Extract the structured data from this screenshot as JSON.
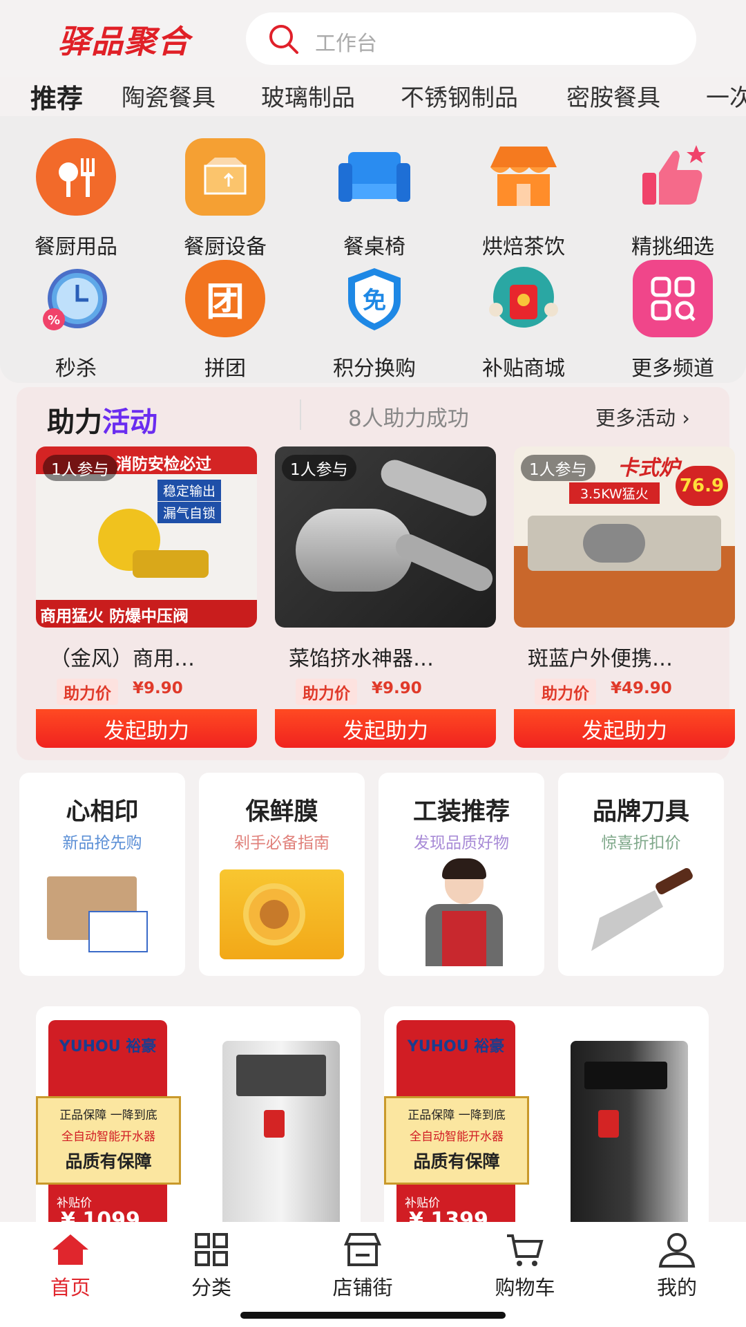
{
  "header": {
    "logo": "驿品聚合",
    "search_placeholder": "工作台"
  },
  "tabs": [
    "推荐",
    "陶瓷餐具",
    "玻璃制品",
    "不锈钢制品",
    "密胺餐具",
    "一次"
  ],
  "categories": [
    {
      "label": "餐厨用品",
      "icon": "tableware-icon",
      "color": "#f26a2a"
    },
    {
      "label": "餐厨设备",
      "icon": "box-icon",
      "color": "#f5a033"
    },
    {
      "label": "餐桌椅",
      "icon": "sofa-icon",
      "color": "#2a8cf0"
    },
    {
      "label": "烘焙茶饮",
      "icon": "shop-icon",
      "color": "#f57a1f"
    },
    {
      "label": "精挑细选",
      "icon": "thumbs-up-icon",
      "color": "#f0436a"
    },
    {
      "label": "秒杀",
      "icon": "alarm-clock-icon",
      "color": "#5fa8e8"
    },
    {
      "label": "拼团",
      "icon": "group-icon",
      "color": "#f2741f",
      "glyph": "团"
    },
    {
      "label": "积分换购",
      "icon": "shield-icon",
      "color": "#1e88e5",
      "glyph": "免"
    },
    {
      "label": "补贴商城",
      "icon": "red-envelope-icon",
      "color": "#2aa7a3"
    },
    {
      "label": "更多频道",
      "icon": "grid-icon",
      "color": "#f0468a"
    }
  ],
  "assist": {
    "title_a": "助力",
    "title_b": "活动",
    "subtitle": "8人助力成功",
    "more": "更多活动",
    "products": [
      {
        "tag": "1人参与",
        "name": "（金风）商用…",
        "price_label": "助力价",
        "price": "¥9.90",
        "button": "发起助力",
        "img_text": "商用猛火 防爆中压阀",
        "img_top": "消防安检必过",
        "img_b1": "稳定输出",
        "img_b2": "漏气自锁"
      },
      {
        "tag": "1人参与",
        "name": "菜馅挤水神器…",
        "price_label": "助力价",
        "price": "¥9.90",
        "button": "发起助力"
      },
      {
        "tag": "1人参与",
        "name": "斑蓝户外便携…",
        "price_label": "助力价",
        "price": "¥49.90",
        "button": "发起助力",
        "img_top": "卡式炉",
        "img_b1": "3.5KW猛火",
        "img_badge": "76.9"
      }
    ]
  },
  "tiles": [
    {
      "title": "心相印",
      "sub": "新品抢先购",
      "sub_color": "#5b8fd6"
    },
    {
      "title": "保鲜膜",
      "sub": "剁手必备指南",
      "sub_color": "#e0807a"
    },
    {
      "title": "工装推荐",
      "sub": "发现品质好物",
      "sub_color": "#a78ad6"
    },
    {
      "title": "品牌刀具",
      "sub": "惊喜折扣价",
      "sub_color": "#7fa88a"
    }
  ],
  "banners": [
    {
      "brand": "YUHOU 裕豪",
      "l1": "正品保障 一降到底",
      "l2": "全自动智能开水器",
      "l3": "品质有保障",
      "price_label": "补贴价",
      "price": "¥ 1099"
    },
    {
      "brand": "YUHOU 裕豪",
      "l1": "正品保障 一降到底",
      "l2": "全自动智能开水器",
      "l3": "品质有保障",
      "price_label": "补贴价",
      "price": "¥ 1399"
    }
  ],
  "nav": [
    {
      "label": "首页",
      "icon": "home-icon",
      "active": true
    },
    {
      "label": "分类",
      "icon": "category-grid-icon",
      "active": false
    },
    {
      "label": "店铺街",
      "icon": "store-icon",
      "active": false
    },
    {
      "label": "购物车",
      "icon": "cart-icon",
      "active": false
    },
    {
      "label": "我的",
      "icon": "user-icon",
      "active": false
    }
  ]
}
